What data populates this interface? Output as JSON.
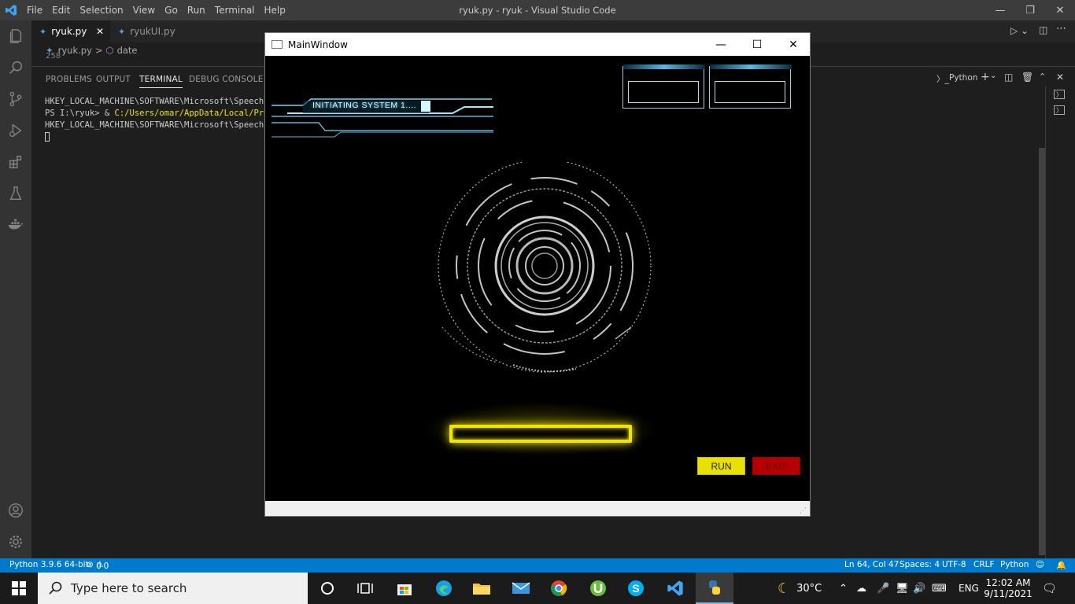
{
  "vscode": {
    "menu": [
      "File",
      "Edit",
      "Selection",
      "View",
      "Go",
      "Run",
      "Terminal",
      "Help"
    ],
    "window_title": "ryuk.py - ryuk - Visual Studio Code",
    "tabs": [
      {
        "label": "ryuk.py",
        "active": true
      },
      {
        "label": "ryukUI.py",
        "active": false
      }
    ],
    "breadcrumb": {
      "file": "ryuk.py",
      "sep": ">",
      "symbol": "date"
    },
    "line_number": "258",
    "panel_tabs": [
      "PROBLEMS",
      "OUTPUT",
      "TERMINAL",
      "DEBUG CONSOLE"
    ],
    "active_panel_tab": "TERMINAL",
    "terminal_profile": "Python",
    "terminal_lines": [
      {
        "prefix": "HKEY_LOCAL_MACHINE\\SOFTWARE\\Microsoft\\Speech\\Vo",
        "highlight": ""
      },
      {
        "prefix": "PS I:\\ryuk> & ",
        "highlight": "C:/Users/omar/AppData/Local/Progr"
      },
      {
        "prefix": "HKEY_LOCAL_MACHINE\\SOFTWARE\\Microsoft\\Speech\\Vo",
        "highlight": ""
      }
    ],
    "status": {
      "python": "Python 3.9.6 64-bit",
      "errors": "0",
      "warnings": "0",
      "position": "Ln 64, Col 47",
      "spaces": "Spaces: 4",
      "encoding": "UTF-8",
      "eol": "CRLF",
      "language": "Python"
    }
  },
  "mainwindow": {
    "title": "MainWindow",
    "hud_text": "INITIATING SYSTEM 1....",
    "run_label": "RUN",
    "exit_label": "EXIT"
  },
  "taskbar": {
    "search_placeholder": "Type here to search",
    "weather": "30°C",
    "language": "ENG",
    "time": "12:02 AM",
    "date": "9/11/2021"
  },
  "colors": {
    "vscode_blue": "#007acc",
    "run_button": "#e8e000",
    "exit_button": "#b40000",
    "glow_bar": "#f2e600"
  }
}
